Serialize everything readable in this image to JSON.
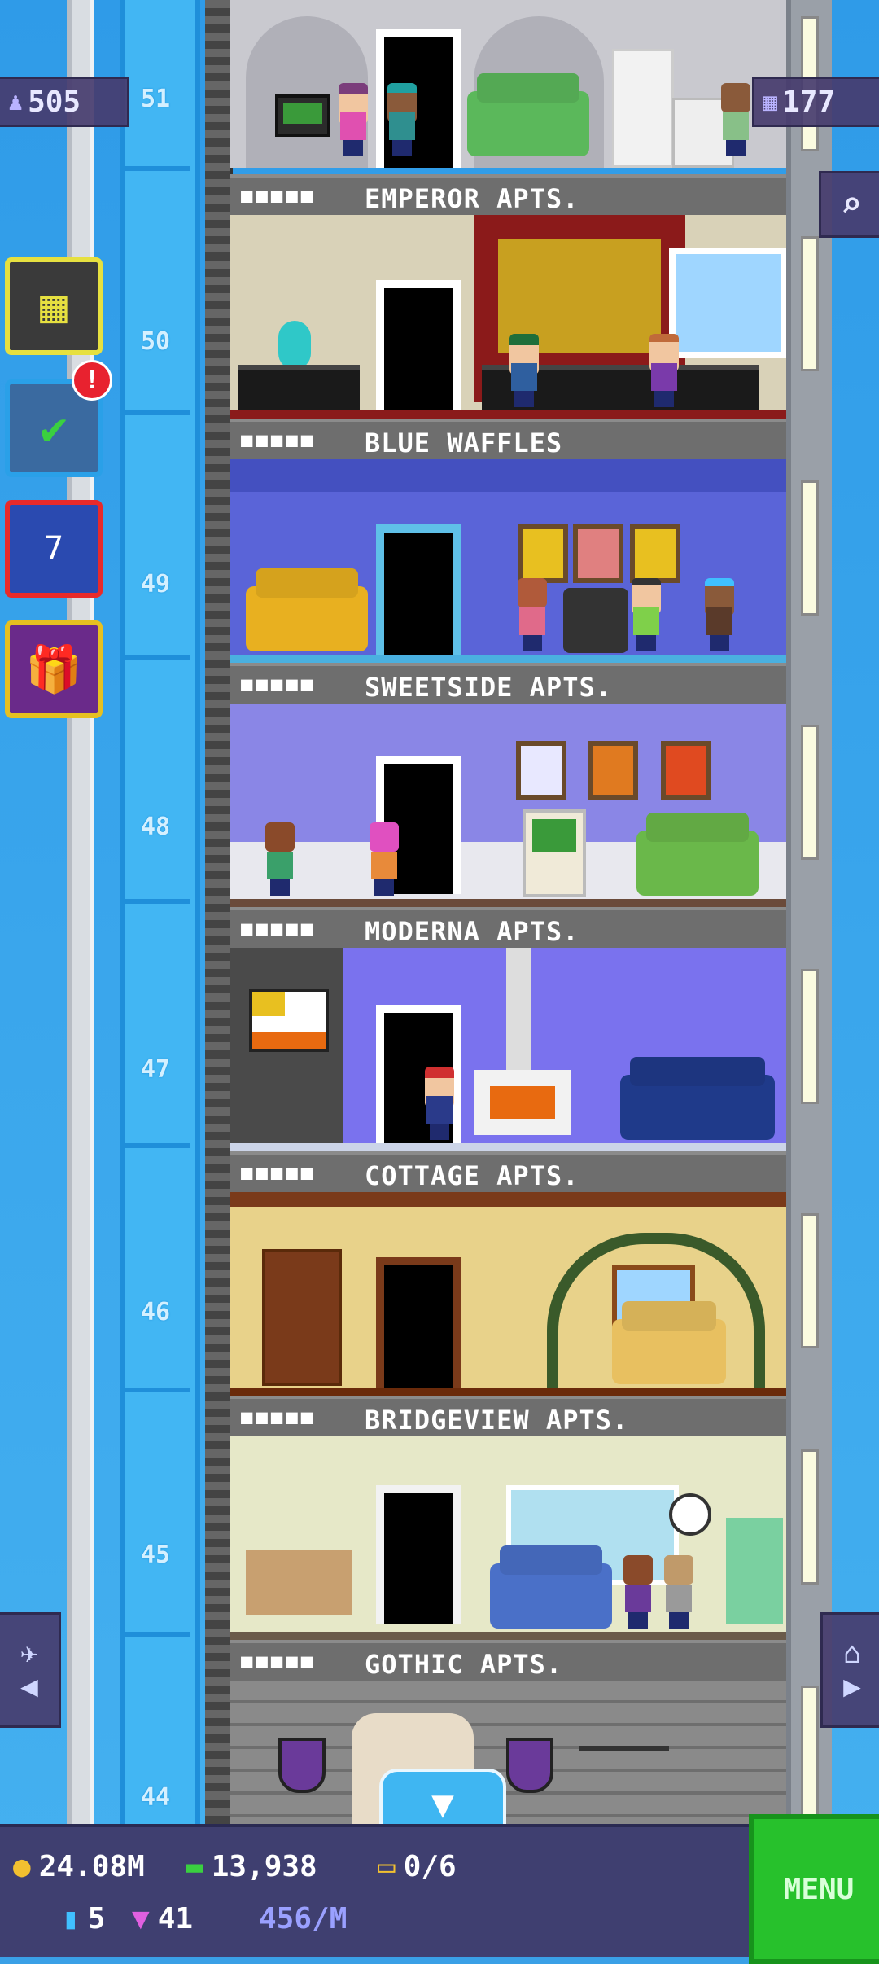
{
  "hud": {
    "population": "505",
    "floor_count": "177",
    "population_icon": "person-icon",
    "floors_icon": "building-icon"
  },
  "shaft": {
    "floor_numbers": [
      "51",
      "50",
      "49",
      "48",
      "47",
      "46",
      "45",
      "44"
    ]
  },
  "floors": [
    {
      "number": "51",
      "name": "EMPEROR APTS.",
      "residents": "■■■■■"
    },
    {
      "number": "50",
      "name": "BLUE WAFFLES",
      "residents": "■■■■■"
    },
    {
      "number": "49",
      "name": "SWEETSIDE APTS.",
      "residents": "■■■■■"
    },
    {
      "number": "48",
      "name": "MODERNA APTS.",
      "residents": "■■■■■"
    },
    {
      "number": "47",
      "name": "COTTAGE APTS.",
      "residents": "■■■■■"
    },
    {
      "number": "46",
      "name": "BRIDGEVIEW APTS.",
      "residents": "■■■■■"
    },
    {
      "number": "45",
      "name": "GOTHIC APTS.",
      "residents": "■■■■■"
    }
  ],
  "side_buttons": [
    {
      "name": "build-floor-button",
      "icon": "building-icon"
    },
    {
      "name": "missions-button",
      "icon": "checklist-icon",
      "badge": "!"
    },
    {
      "name": "calendar-button",
      "icon": "calendar-icon",
      "label": "7"
    },
    {
      "name": "gift-button",
      "icon": "gift-icon"
    }
  ],
  "currency": {
    "coins": "24.08M",
    "bux": "13,938",
    "tickets": "0/6",
    "lobby_items": "5",
    "vip": "41",
    "rate": "456/M"
  },
  "menu_label": "MENU",
  "colors": {
    "sky": "#3aa0e6",
    "shaft": "#42b6f3",
    "menu_green": "#27c12c",
    "hud_panel": "#463c6e"
  }
}
